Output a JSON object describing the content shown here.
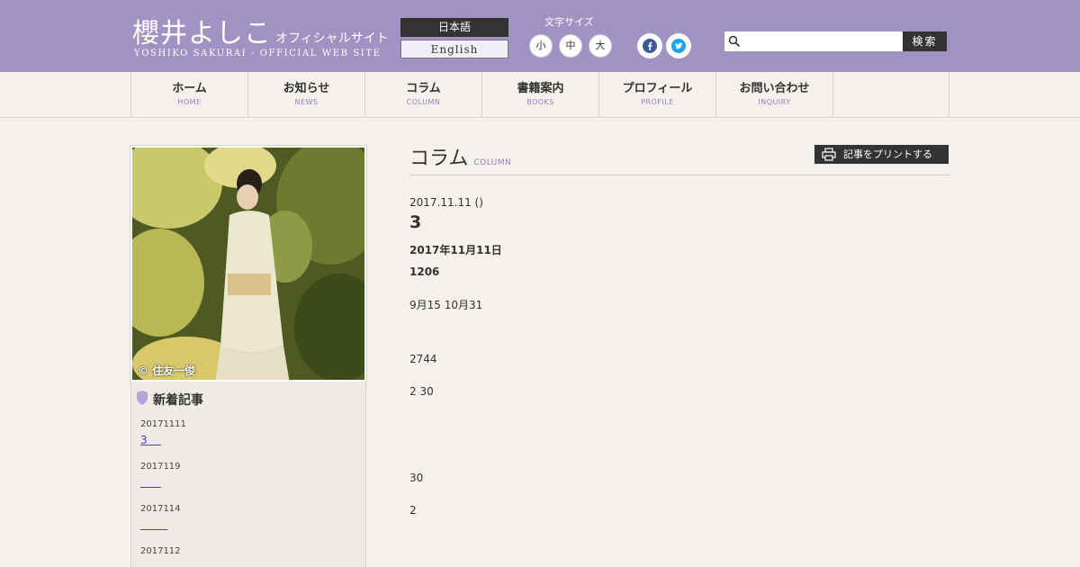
{
  "header": {
    "logo_main": "櫻井よしこ",
    "logo_tagline": "オフィシャルサイト",
    "logo_sub": "YOSHIKO SAKURAI - OFFICIAL WEB SITE",
    "lang_ja": "日本語",
    "lang_en": "English",
    "font_size_label": "文字サイズ",
    "font_small": "小",
    "font_medium": "中",
    "font_large": "大",
    "search_placeholder": "",
    "search_button": "検索",
    "brand_color": "#a093c3"
  },
  "nav": [
    {
      "ja": "ホーム",
      "en": "HOME"
    },
    {
      "ja": "お知らせ",
      "en": "NEWS"
    },
    {
      "ja": "コラム",
      "en": "COLUMN"
    },
    {
      "ja": "書籍案内",
      "en": "BOOKS"
    },
    {
      "ja": "プロフィール",
      "en": "PROFILE"
    },
    {
      "ja": "お問い合わせ",
      "en": "INQUIRY"
    }
  ],
  "sidebar": {
    "photo_credit": "© 住友一俊",
    "new_posts_title": "新着記事",
    "posts": [
      {
        "date": "20171111",
        "title": "3    "
      },
      {
        "date": "2017119",
        "title": "      "
      },
      {
        "date": "2017114",
        "title": "        "
      },
      {
        "date": "2017112",
        "title": ""
      }
    ]
  },
  "main": {
    "section_title": "コラム",
    "section_title_en": "COLUMN",
    "print_button": "記事をプリントする",
    "article_date": "2017.11.11 ()",
    "article_title": "3",
    "meta_line1_prefix": "",
    "meta_line1_bold": "2017年11月11日",
    "meta_line2_prefix": "",
    "meta_line2_bold": "1206",
    "paragraphs": [
      "9月15 10月31",
      "2744",
      "2 30",
      "",
      "30",
      "2"
    ]
  }
}
